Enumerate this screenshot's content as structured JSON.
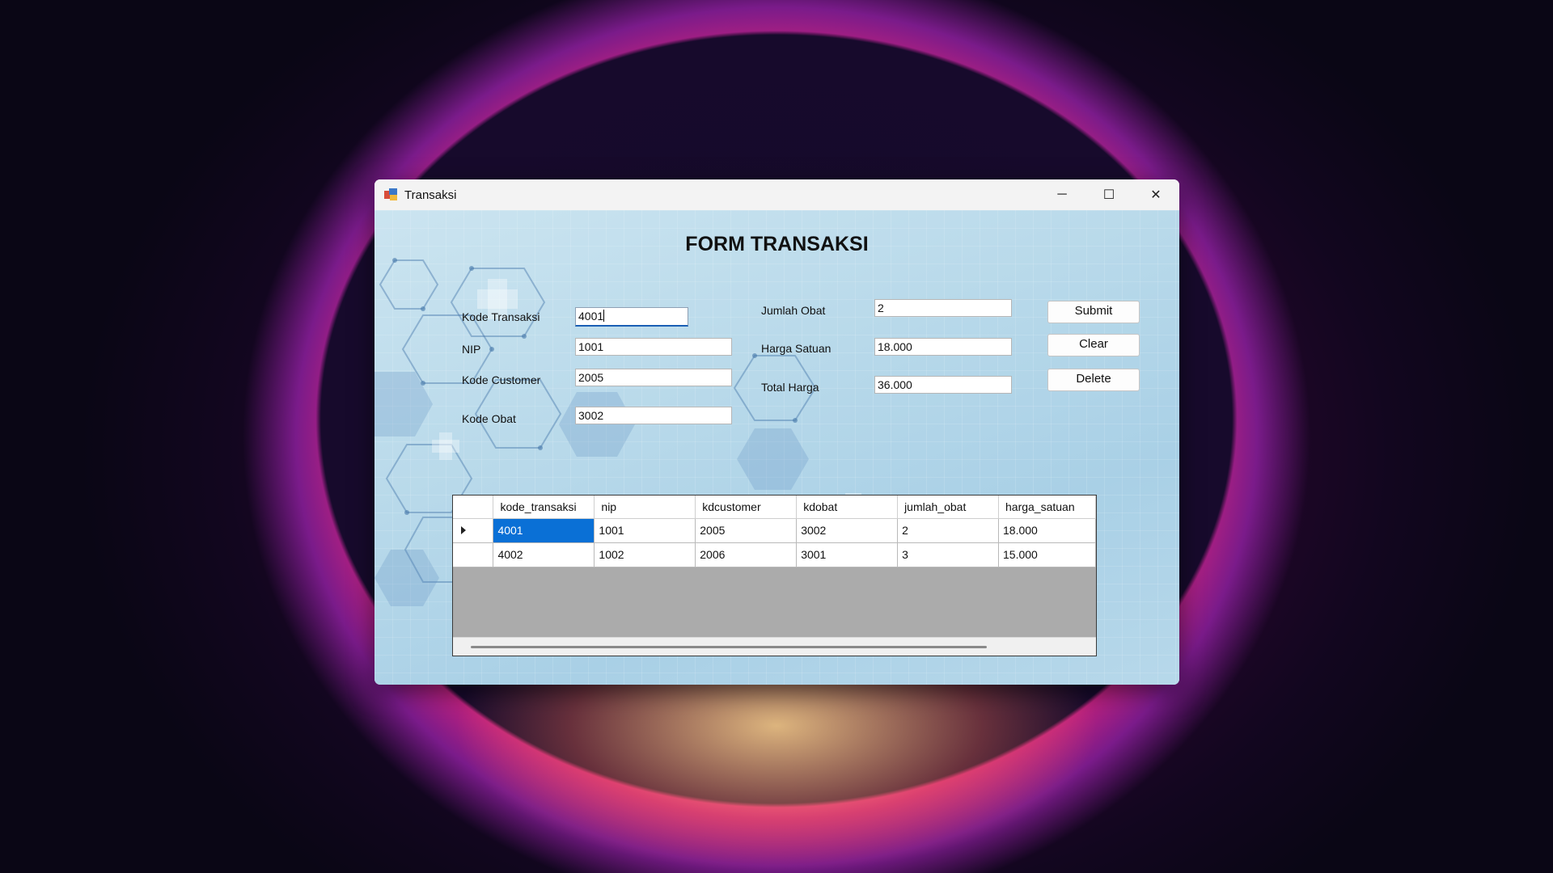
{
  "window": {
    "title": "Transaksi",
    "minimize_glyph": "─",
    "maximize_glyph": "☐",
    "close_glyph": "✕"
  },
  "form": {
    "heading": "FORM TRANSAKSI",
    "fields": {
      "kode_transaksi": {
        "label": "Kode Transaksi",
        "value": "4001"
      },
      "nip": {
        "label": "NIP",
        "value": "1001"
      },
      "kode_customer": {
        "label": "Kode Customer",
        "value": "2005"
      },
      "kode_obat": {
        "label": "Kode Obat",
        "value": "3002"
      },
      "jumlah_obat": {
        "label": "Jumlah Obat",
        "value": "2"
      },
      "harga_satuan": {
        "label": "Harga Satuan",
        "value": "18.000"
      },
      "total_harga": {
        "label": "Total Harga",
        "value": "36.000"
      }
    },
    "buttons": {
      "submit": "Submit",
      "clear": "Clear",
      "delete": "Delete"
    }
  },
  "grid": {
    "columns": [
      "kode_transaksi",
      "nip",
      "kdcustomer",
      "kdobat",
      "jumlah_obat",
      "harga_satuan"
    ],
    "rows": [
      [
        "4001",
        "1001",
        "2005",
        "3002",
        "2",
        "18.000"
      ],
      [
        "4002",
        "1002",
        "2006",
        "3001",
        "3",
        "15.000"
      ]
    ],
    "selected_row": 0
  },
  "colors": {
    "selection": "#0a70d6",
    "focus_underline": "#1a5fb4"
  },
  "icons": {
    "app": "app-icon",
    "row_indicator": "triangle-right-icon"
  }
}
